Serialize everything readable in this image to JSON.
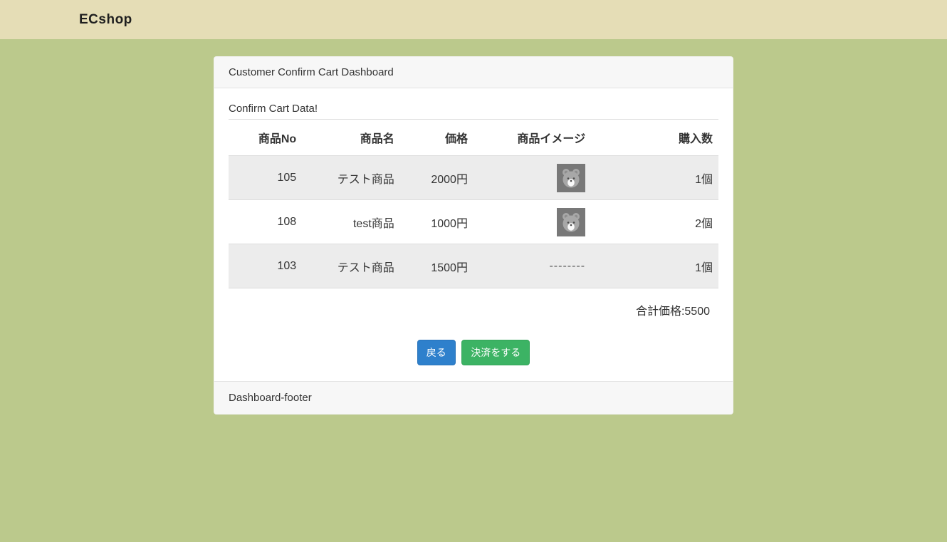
{
  "navbar": {
    "brand": "ECshop"
  },
  "card": {
    "header_title": "Customer Confirm Cart Dashboard",
    "body_title": "Confirm Cart Data!",
    "footer_text": "Dashboard-footer"
  },
  "table": {
    "headers": [
      "商品No",
      "商品名",
      "価格",
      "商品イメージ",
      "購入数"
    ],
    "rows": [
      {
        "no": "105",
        "name": "テスト商品",
        "price": "2000円",
        "image": "bear-placeholder-image",
        "qty": "1個"
      },
      {
        "no": "108",
        "name": "test商品",
        "price": "1000円",
        "image": "bear-placeholder-image",
        "qty": "2個"
      },
      {
        "no": "103",
        "name": "テスト商品",
        "price": "1500円",
        "image": "--------",
        "qty": "1個"
      }
    ]
  },
  "total_label": "合計価格:5500",
  "buttons": {
    "back": "戻る",
    "checkout": "決済をする"
  },
  "colors": {
    "navbar_bg": "#e5ddb6",
    "page_bg": "#bbc98c",
    "card_section_bg": "#f7f7f7",
    "stripe_row_bg": "#ececec",
    "border": "#dddddd",
    "primary_button": "#2e80cc",
    "success_button": "#3cb364",
    "text": "#333333"
  }
}
